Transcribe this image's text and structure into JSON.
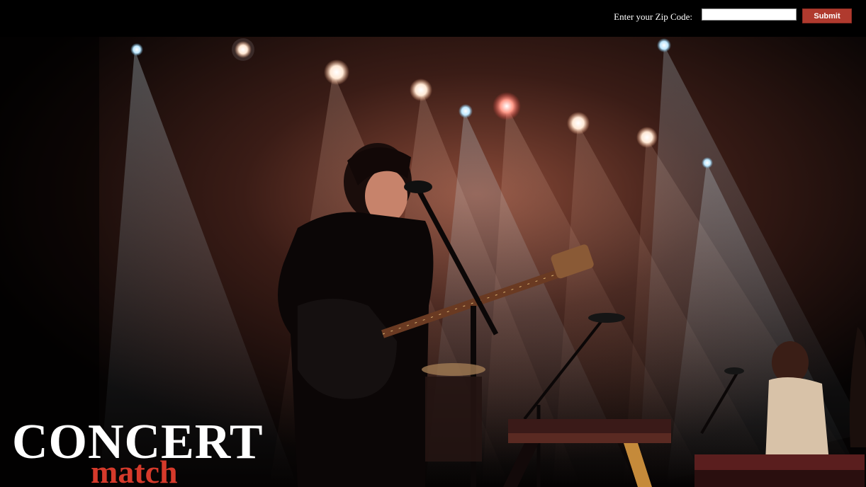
{
  "header": {
    "zip_label": "Enter your Zip Code:",
    "zip_value": "",
    "zip_placeholder": "",
    "submit_label": "Submit"
  },
  "hero": {
    "image": "concert-stage-photo"
  },
  "logo": {
    "word1": "CONCERT",
    "word2": "match"
  },
  "colors": {
    "background": "#000000",
    "submit": "#b03a2e",
    "logo_accent": "#d63a2b",
    "logo_main": "#ffffff"
  }
}
